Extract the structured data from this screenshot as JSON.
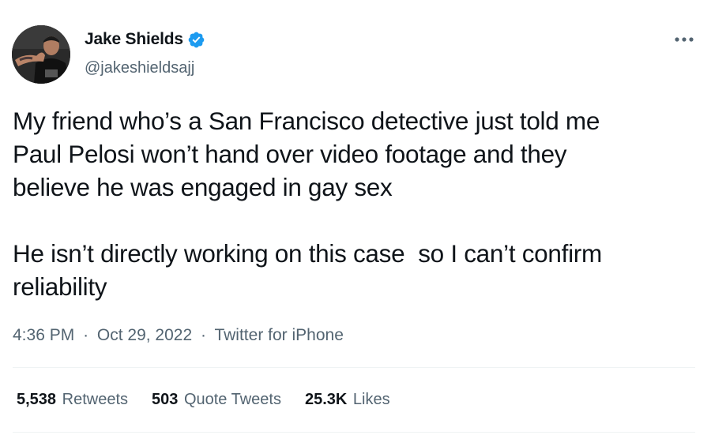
{
  "author": {
    "display_name": "Jake Shields",
    "handle": "@jakeshieldsajj",
    "verified": true,
    "avatar": "profile-photo",
    "verified_color": "#1d9bf0"
  },
  "more_icon": "ellipsis-icon",
  "tweet": {
    "text": "My friend who’s a San Francisco detective just told me\nPaul Pelosi won’t hand over video footage and they\nbelieve he was engaged in gay sex\n\nHe isn’t directly working on this case  so I can’t confirm\nreliability"
  },
  "meta": {
    "time": "4:36 PM",
    "separator": "·",
    "date": "Oct 29, 2022",
    "client": "Twitter for iPhone"
  },
  "stats": {
    "retweets": {
      "count": "5,538",
      "label": "Retweets"
    },
    "quote_tweets": {
      "count": "503",
      "label": "Quote Tweets"
    },
    "likes": {
      "count": "25.3K",
      "label": "Likes"
    }
  },
  "colors": {
    "text": "#0f1419",
    "secondary": "#536471",
    "divider": "#eff3f4"
  }
}
